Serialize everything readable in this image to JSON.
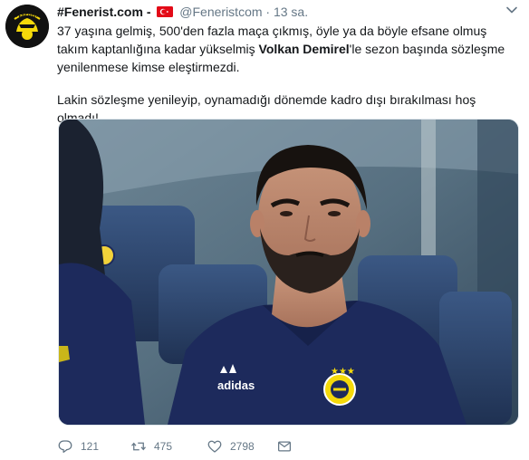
{
  "author": {
    "name": "#Fenerist.com",
    "dash": "-",
    "handle": "@Feneristcom",
    "separator": "·",
    "time": "13 sa.",
    "avatar_text": "FENERIST",
    "flag_country": "Turkey"
  },
  "tweet": {
    "p1_a": "37 yaşına gelmiş, 500'den fazla maça çıkmış, öyle ya da böyle efsane olmuş takım kaptanlığına kadar yükselmiş ",
    "p1_bold": "Volkan Demirel",
    "p1_b": "'le sezon başında sözleşme yenilenmese kimse eleştirmezdi.",
    "p2": "Lakin sözleşme yenileyip, oynamadığı dönemde kadro dışı bırakılması hoş olmadı!"
  },
  "media": {
    "jersey_brand": "adidas"
  },
  "actions": {
    "replies": "121",
    "retweets": "475",
    "likes": "2798"
  },
  "colors": {
    "text": "#14171a",
    "muted": "#657786",
    "jersey": "#1d2a5c",
    "seat": "#2b4166",
    "avatar_bg": "#111111",
    "avatar_accent": "#f5d90a"
  },
  "icons": [
    "caret-down-icon",
    "reply-icon",
    "retweet-icon",
    "like-icon",
    "message-icon",
    "turkey-flag-icon"
  ]
}
